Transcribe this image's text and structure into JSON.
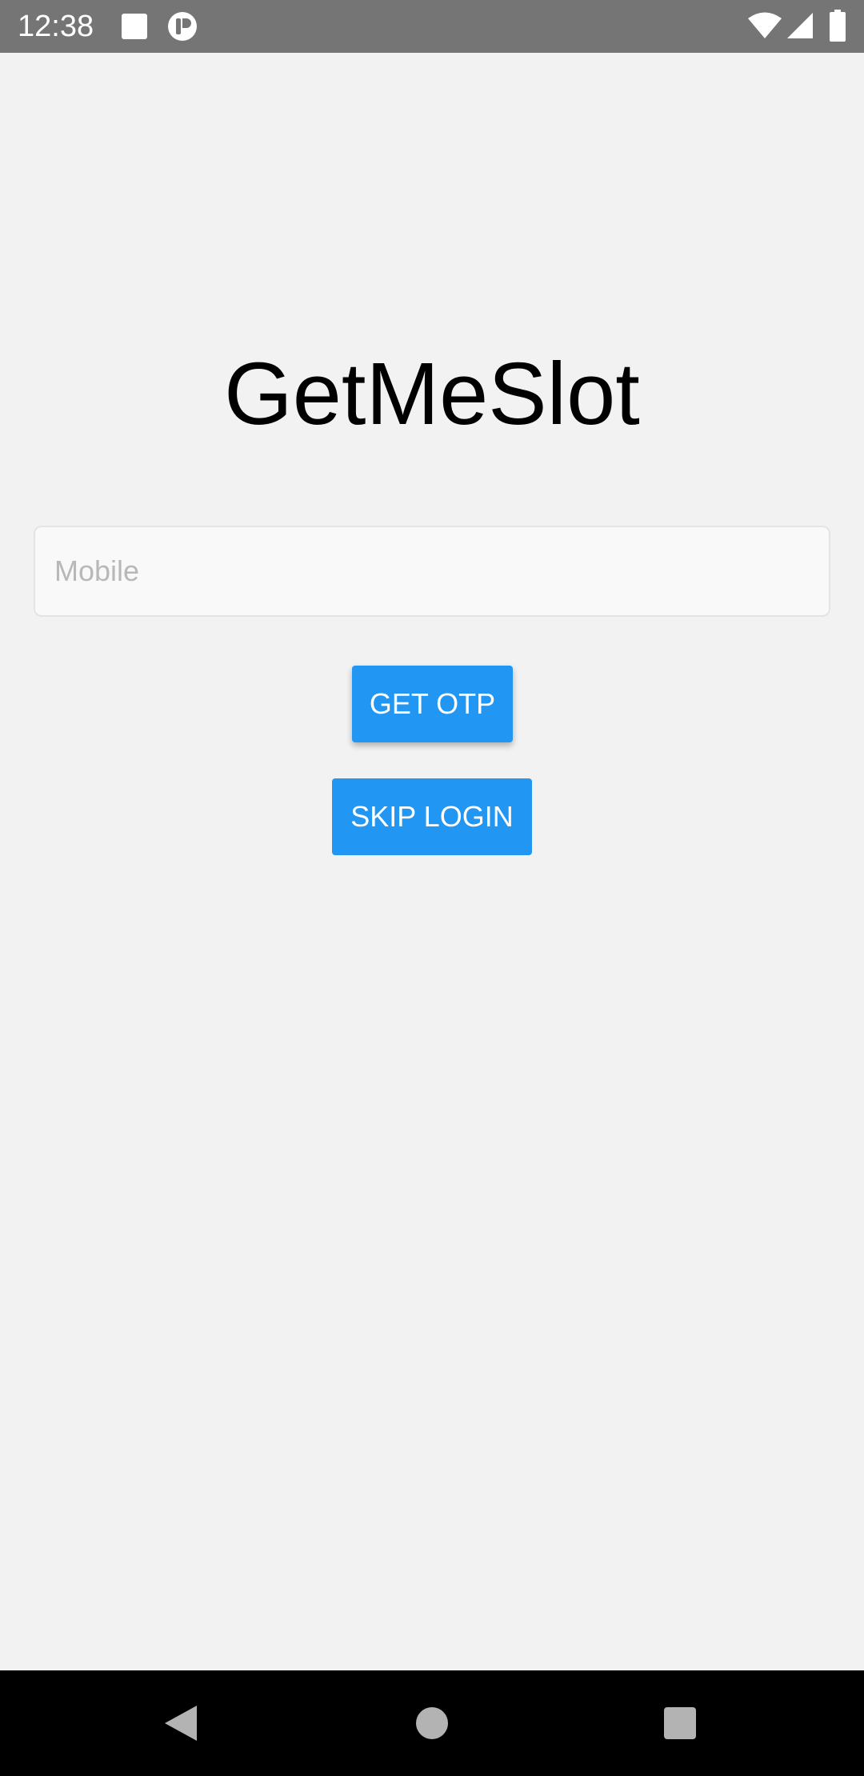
{
  "status_bar": {
    "time": "12:38",
    "icons": [
      "square-notification-icon",
      "app-notification-icon",
      "wifi-icon",
      "cell-signal-icon",
      "battery-icon"
    ]
  },
  "app": {
    "title": "GetMeSlot",
    "mobile_input": {
      "placeholder": "Mobile",
      "value": ""
    },
    "get_otp_label": "GET OTP",
    "skip_login_label": "SKIP LOGIN"
  },
  "nav_bar": {
    "icons": [
      "back-icon",
      "home-icon",
      "recents-icon"
    ]
  },
  "colors": {
    "background": "#f2f2f2",
    "status_bar": "#757575",
    "accent": "#2196f3",
    "nav_bar": "#000000"
  }
}
